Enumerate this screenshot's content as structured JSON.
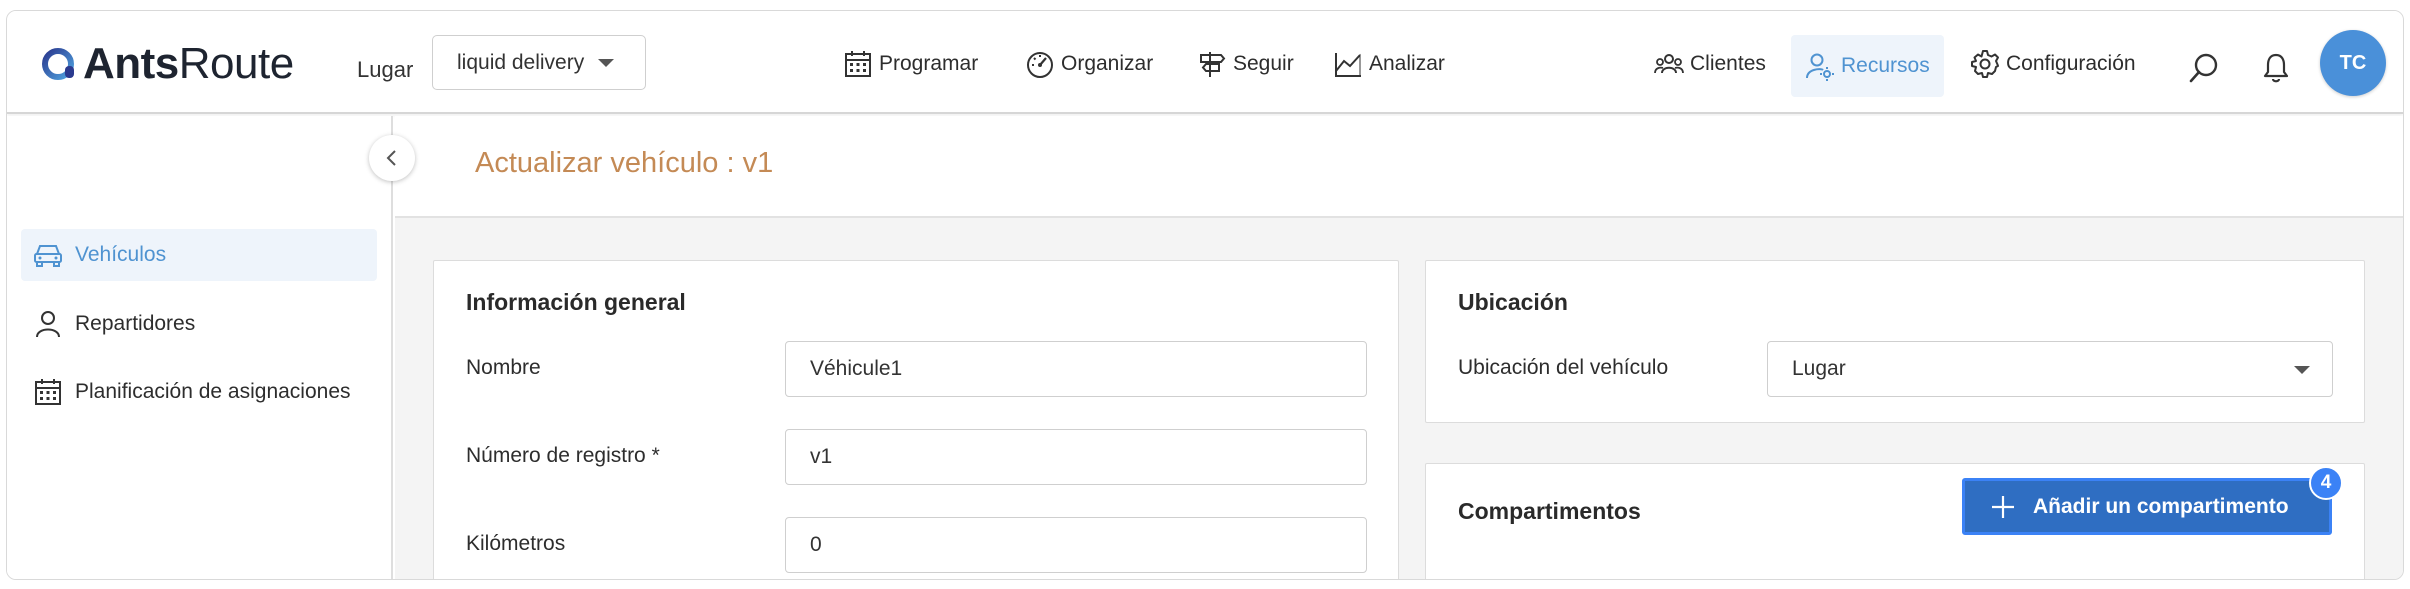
{
  "app": {
    "logo_bold": "Ants",
    "logo_light": "Route"
  },
  "header": {
    "place_label": "Lugar",
    "place_value": "liquid delivery",
    "nav": [
      {
        "label": "Programar",
        "icon": "calendar-icon"
      },
      {
        "label": "Organizar",
        "icon": "gauge-icon"
      },
      {
        "label": "Seguir",
        "icon": "signpost-icon"
      },
      {
        "label": "Analizar",
        "icon": "chart-icon"
      },
      {
        "label": "Clientes",
        "icon": "customers-icon"
      },
      {
        "label": "Recursos",
        "icon": "resources-icon",
        "active": true
      },
      {
        "label": "Configuración",
        "icon": "gear-icon"
      }
    ],
    "avatar_initials": "TC"
  },
  "sidebar": {
    "items": [
      {
        "label": "Vehículos",
        "icon": "car-icon",
        "active": true
      },
      {
        "label": "Repartidores",
        "icon": "person-icon"
      },
      {
        "label": "Planificación de asignaciones",
        "icon": "calendar-icon"
      }
    ]
  },
  "page": {
    "title": "Actualizar vehículo : v1"
  },
  "general_info": {
    "title": "Información general",
    "name_label": "Nombre",
    "name_value": "Véhicule1",
    "registration_label": "Número de registro *",
    "registration_value": "v1",
    "km_label": "Kilómetros",
    "km_value": "0"
  },
  "location": {
    "title": "Ubicación",
    "vehicle_location_label": "Ubicación del vehículo",
    "vehicle_location_value": "Lugar"
  },
  "compartments": {
    "title": "Compartimentos",
    "add_label": "Añadir un compartimento",
    "badge": "4"
  },
  "colors": {
    "accent": "#4f93d1",
    "primary_button": "#2f6ec2",
    "title_orange": "#c48a55",
    "avatar": "#4a90d9"
  }
}
